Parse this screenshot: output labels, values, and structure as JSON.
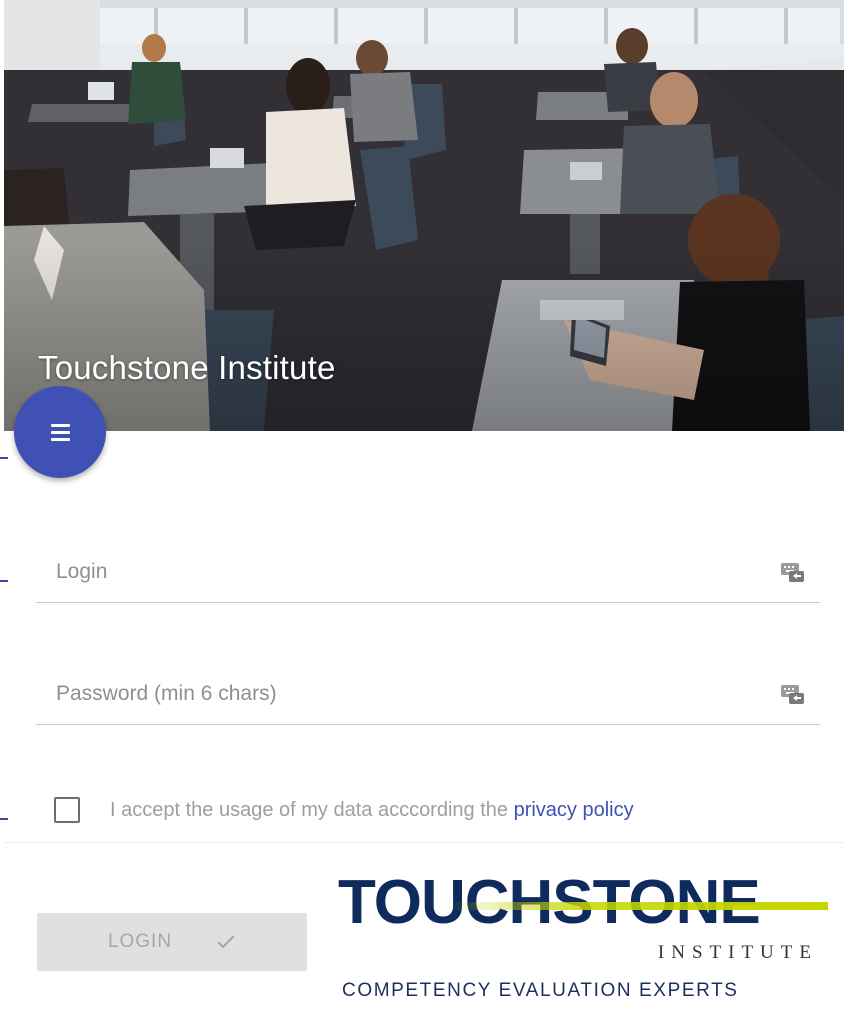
{
  "hero": {
    "title": "Touchstone Institute"
  },
  "menu": {
    "icon": "menu-icon",
    "color": "#3f51b5"
  },
  "form": {
    "login": {
      "placeholder": "Login",
      "value": "",
      "icon": "keyboard-icon"
    },
    "password": {
      "placeholder": "Password (min 6 chars)",
      "value": "",
      "icon": "keyboard-icon"
    },
    "consent": {
      "checked": false,
      "text": "I accept the usage of my data acccording the ",
      "link_text": "privacy policy"
    },
    "submit": {
      "label": "LOGIN",
      "icon": "check-icon",
      "enabled": false
    }
  },
  "logo": {
    "wordmark": "TOUCHSTONE",
    "subtitle": "INSTITUTE",
    "tagline": "COMPETENCY EVALUATION EXPERTS",
    "colors": {
      "navy": "#0f2a5c",
      "accent": "#c4d600"
    }
  }
}
